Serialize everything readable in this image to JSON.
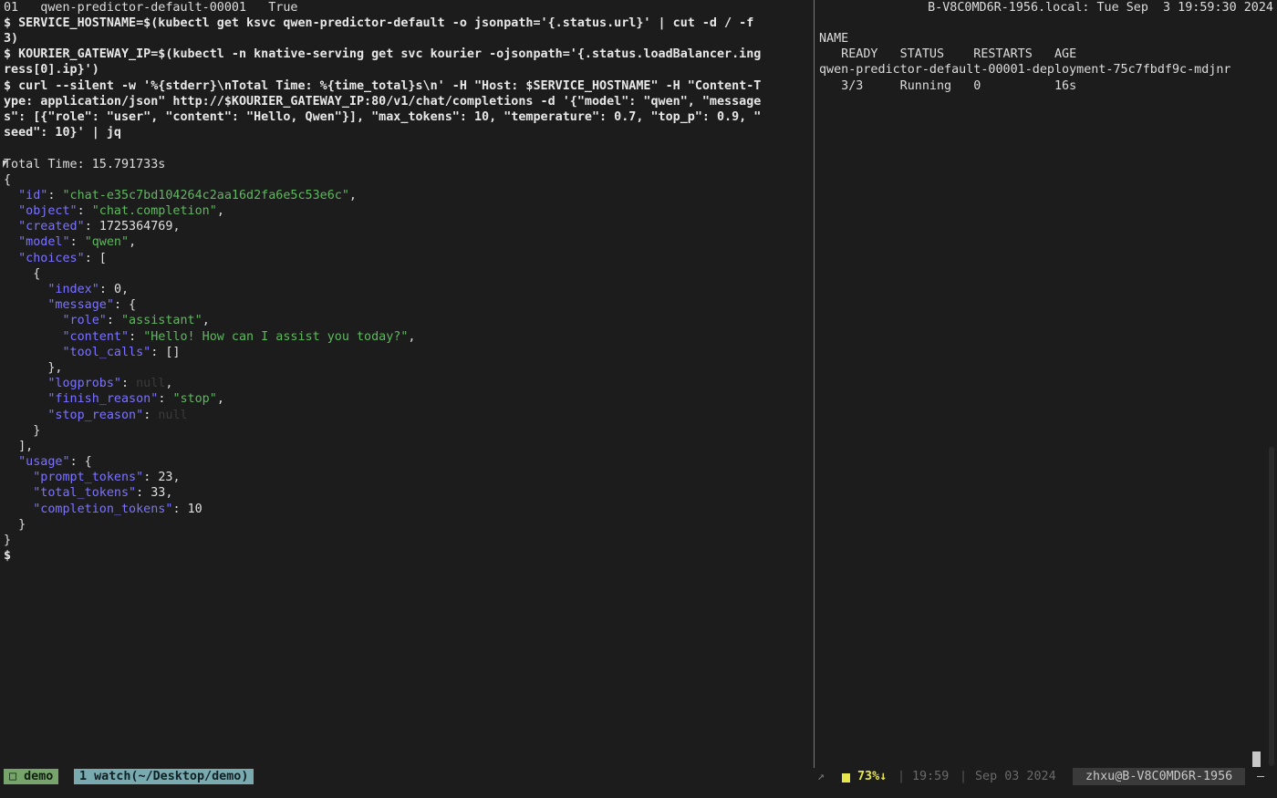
{
  "left_pane": {
    "lines": [
      "01   qwen-predictor-default-00001   True",
      "$ SERVICE_HOSTNAME=$(kubectl get ksvc qwen-predictor-default -o jsonpath='{.status.url}' | cut -d / -f",
      "3)",
      "$ KOURIER_GATEWAY_IP=$(kubectl -n knative-serving get svc kourier -ojsonpath='{.status.loadBalancer.ing",
      "ress[0].ip}')",
      "$ curl --silent -w '%{stderr}\\nTotal Time: %{time_total}s\\n' -H \"Host: $SERVICE_HOSTNAME\" -H \"Content-T",
      "ype: application/json\" http://$KOURIER_GATEWAY_IP:80/v1/chat/completions -d '{\"model\": \"qwen\", \"message",
      "s\": [{\"role\": \"user\", \"content\": \"Hello, Qwen\"}], \"max_tokens\": 10, \"temperature\": 0.7, \"top_p\": 0.9, \"",
      "seed\": 10}' | jq",
      "Total Time: 15.791733s"
    ],
    "json": {
      "id_key": "\"id\"",
      "id_val": "\"chat-e35c7bd104264c2aa16d2fa6e5c53e6c\"",
      "object_key": "\"object\"",
      "object_val": "\"chat.completion\"",
      "created_key": "\"created\"",
      "created_val": "1725364769",
      "model_key": "\"model\"",
      "model_val": "\"qwen\"",
      "choices_key": "\"choices\"",
      "index_key": "\"index\"",
      "index_val": "0",
      "message_key": "\"message\"",
      "role_key": "\"role\"",
      "role_val": "\"assistant\"",
      "content_key": "\"content\"",
      "content_val": "\"Hello! How can I assist you today?\"",
      "tool_calls_key": "\"tool_calls\"",
      "tool_calls_val": "[]",
      "logprobs_key": "\"logprobs\"",
      "logprobs_val": "null",
      "finish_reason_key": "\"finish_reason\"",
      "finish_reason_val": "\"stop\"",
      "stop_reason_key": "\"stop_reason\"",
      "stop_reason_val": "null",
      "usage_key": "\"usage\"",
      "prompt_tokens_key": "\"prompt_tokens\"",
      "prompt_tokens_val": "23",
      "total_tokens_key": "\"total_tokens\"",
      "total_tokens_val": "33",
      "completion_tokens_key": "\"completion_tokens\"",
      "completion_tokens_val": "10"
    },
    "prompt": "$"
  },
  "right_pane": {
    "header_host": "B-V8C0MD6R-1956.local: Tue Sep  3 19:59:30 2024",
    "col_name": "NAME",
    "col_headers": "   READY   STATUS    RESTARTS   AGE",
    "pod_name": "qwen-predictor-default-00001-deployment-75c7fbdf9c-mdjnr",
    "pod_values": "   3/3     Running   0          16s"
  },
  "statusbar": {
    "session": "□ demo",
    "window": "1 watch(~/Desktop/demo)",
    "arrow": "↗",
    "battery": "73%↓",
    "sep": "|",
    "time": "19:59",
    "date": "Sep 03 2024",
    "host": "zhxu@B-V8C0MD6R-1956",
    "end": "–"
  }
}
